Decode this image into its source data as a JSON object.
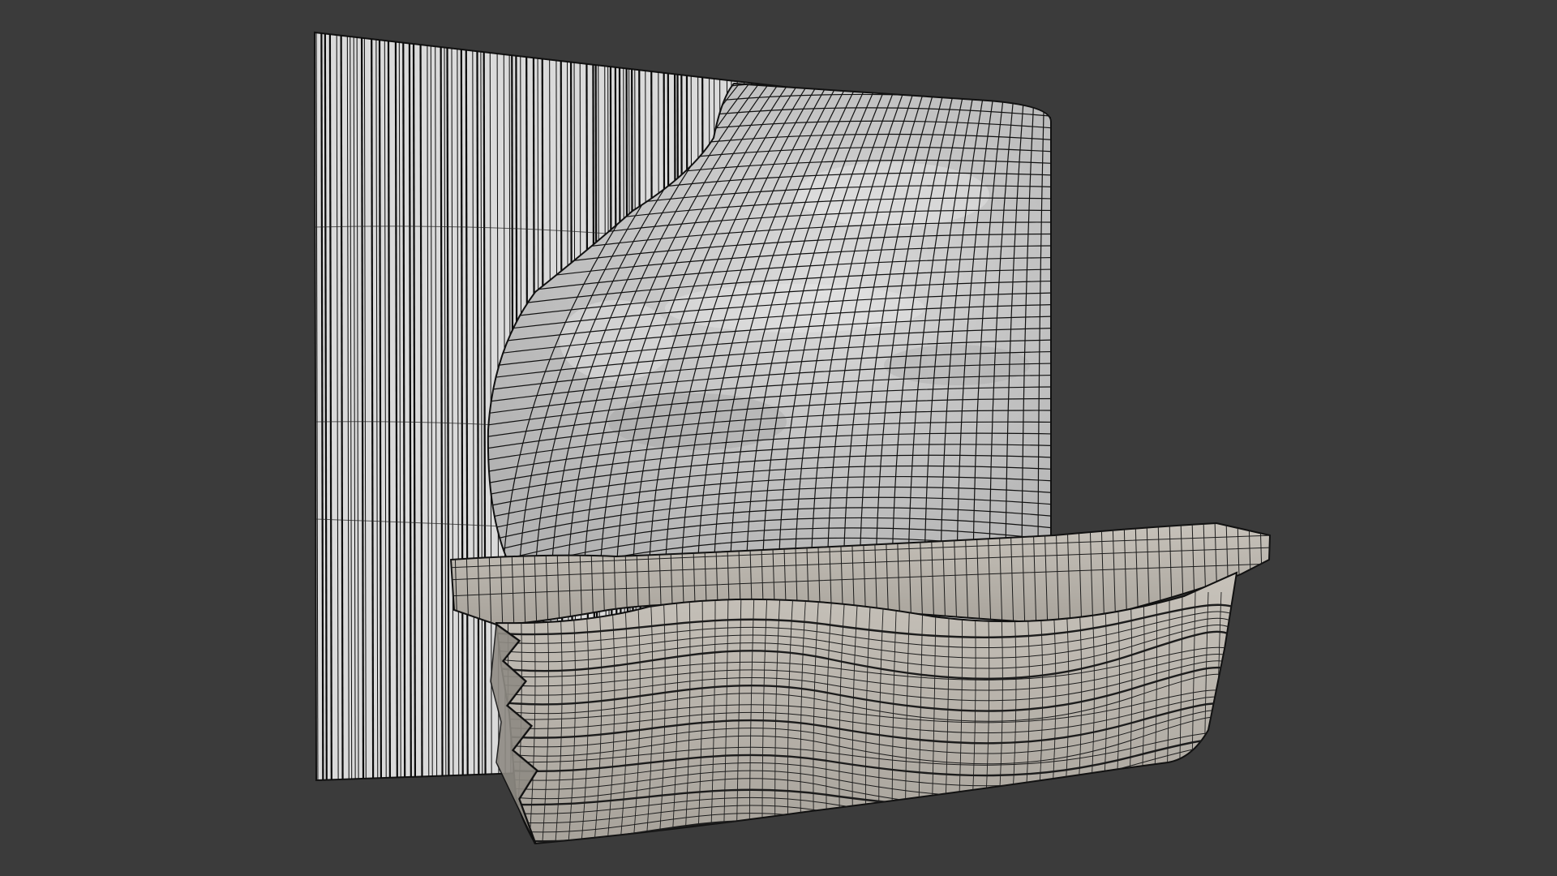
{
  "viewport": {
    "background_color": "#3b3b3b"
  },
  "scene": {
    "objects": [
      {
        "name": "vertical-slat-wall-panel",
        "display_mode": "wireframe-on-shaded",
        "surface_color": "#d8d8d8",
        "wire_color": "#0a0a0a"
      },
      {
        "name": "curved-marble-wall-panel",
        "display_mode": "wireframe-on-shaded",
        "surface_color": "#c9c9c9",
        "wire_color": "#111111"
      },
      {
        "name": "wavy-reception-desk",
        "display_mode": "wireframe-on-shaded",
        "surface_color": "#b9b4ac",
        "wire_color": "#1a1a1a"
      }
    ]
  }
}
